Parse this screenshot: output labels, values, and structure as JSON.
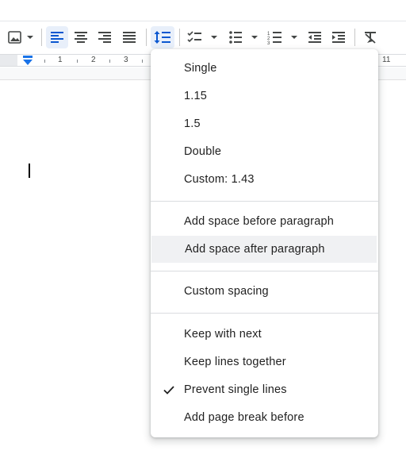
{
  "ruler": {
    "numbers": [
      "1",
      "2",
      "3",
      "11"
    ]
  },
  "menu": {
    "line_spacing": [
      "Single",
      "1.15",
      "1.5",
      "Double",
      "Custom: 1.43"
    ],
    "paragraph_space": [
      "Add space before paragraph",
      "Add space after paragraph"
    ],
    "custom": "Custom spacing",
    "pagination": [
      "Keep with next",
      "Keep lines together",
      "Prevent single lines",
      "Add page break before"
    ],
    "checked_item": "Prevent single lines",
    "hovered_item": "Add space after paragraph"
  },
  "colors": {
    "accent": "#0b57d0",
    "active_bg": "#e8effa",
    "hover_bg": "#f0f1f3"
  },
  "icons": [
    "image-icon",
    "align-left-icon",
    "align-center-icon",
    "align-right-icon",
    "justify-icon",
    "line-spacing-icon",
    "checklist-icon",
    "bulleted-list-icon",
    "numbered-list-icon",
    "decrease-indent-icon",
    "increase-indent-icon",
    "clear-formatting-icon",
    "checkmark-icon"
  ]
}
